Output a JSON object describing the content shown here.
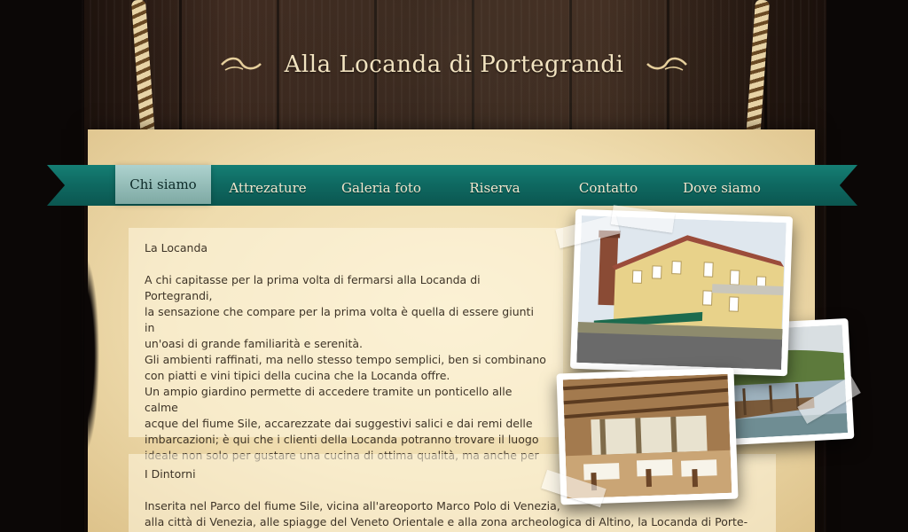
{
  "site": {
    "title": "Alla Locanda di Portegrandi"
  },
  "nav": {
    "items": [
      {
        "label": "Chi siamo",
        "active": true
      },
      {
        "label": "Attrezature",
        "active": false
      },
      {
        "label": "Galeria foto",
        "active": false
      },
      {
        "label": "Riserva",
        "active": false
      },
      {
        "label": "Contatto",
        "active": false
      },
      {
        "label": "Dove siamo",
        "active": false
      }
    ]
  },
  "sections": [
    {
      "heading": "La Locanda",
      "body": "A chi capitasse per la prima volta di fermarsi alla Locanda di Portegrandi,\nla sensazione che compare per la prima volta è quella di essere giunti in\nun'oasi di grande familiarità e serenità.\nGli ambienti raffinati, ma nello stesso tempo semplici, ben si combinano\ncon piatti e vini tipici della cucina che la Locanda offre.\nUn ampio giardino permette di accedere tramite un ponticello alle calme\nacque del fiume Sile, accarezzate dai suggestivi salici e dai remi delle\nimbarcazioni; è qui che i clienti della Locanda potranno trovare il luogo\nideale non solo per gustare una cucina di ottima qualità, ma anche per"
    },
    {
      "heading": "I Dintorni",
      "body": "Inserita nel Parco del fiume Sile, vicina all'areoporto Marco Polo di Venezia,\nalla città di Venezia, alle spiagge del Veneto Orientale e alla zona archeologica di Altino, la Locanda di Porte-"
    }
  ],
  "photos": [
    {
      "subject": "locanda building exterior"
    },
    {
      "subject": "river Sile with willows"
    },
    {
      "subject": "restaurant dining room"
    }
  ],
  "colors": {
    "ribbon": "#0f6a62",
    "paper": "#efdcae",
    "wood": "#3b271d",
    "title": "#f2e3c0",
    "text": "#3e3427"
  }
}
